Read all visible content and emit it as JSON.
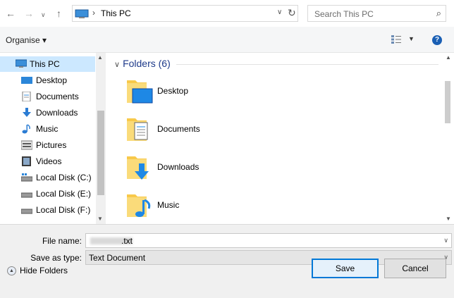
{
  "nav": {
    "back_icon": "arrow-left",
    "forward_icon": "arrow-right",
    "recent_icon": "chevron-down",
    "up_icon": "arrow-up"
  },
  "address": {
    "separator": "›",
    "crumb": "This PC",
    "dropdown": "∨",
    "refresh": "↻"
  },
  "search": {
    "placeholder": "Search This PC",
    "icon": "⌕"
  },
  "toolbar": {
    "organise": "Organise ▾",
    "view_dropdown": "▼",
    "help": "?"
  },
  "sidebar": {
    "items": [
      {
        "label": "This PC",
        "icon": "this-pc",
        "selected": true
      },
      {
        "label": "Desktop",
        "icon": "desktop"
      },
      {
        "label": "Documents",
        "icon": "documents"
      },
      {
        "label": "Downloads",
        "icon": "downloads"
      },
      {
        "label": "Music",
        "icon": "music"
      },
      {
        "label": "Pictures",
        "icon": "pictures"
      },
      {
        "label": "Videos",
        "icon": "videos"
      },
      {
        "label": "Local Disk (C:)",
        "icon": "local-disk-c"
      },
      {
        "label": "Local Disk (E:)",
        "icon": "local-disk"
      },
      {
        "label": "Local Disk (F:)",
        "icon": "local-disk"
      }
    ]
  },
  "main": {
    "group_header": "Folders (6)",
    "folders": [
      {
        "label": "Desktop",
        "icon": "desktop-folder"
      },
      {
        "label": "Documents",
        "icon": "documents-folder"
      },
      {
        "label": "Downloads",
        "icon": "downloads-folder"
      },
      {
        "label": "Music",
        "icon": "music-folder"
      }
    ]
  },
  "form": {
    "file_name_label": "File name:",
    "file_name_value": ".txt",
    "save_as_label": "Save as type:",
    "save_as_value": "Text Document"
  },
  "footer": {
    "hide_folders": "Hide Folders",
    "save": "Save",
    "cancel": "Cancel"
  },
  "colors": {
    "accent": "#0078d7",
    "selected_bg": "#cce8ff",
    "folder_yellow": "#f8c94a"
  }
}
